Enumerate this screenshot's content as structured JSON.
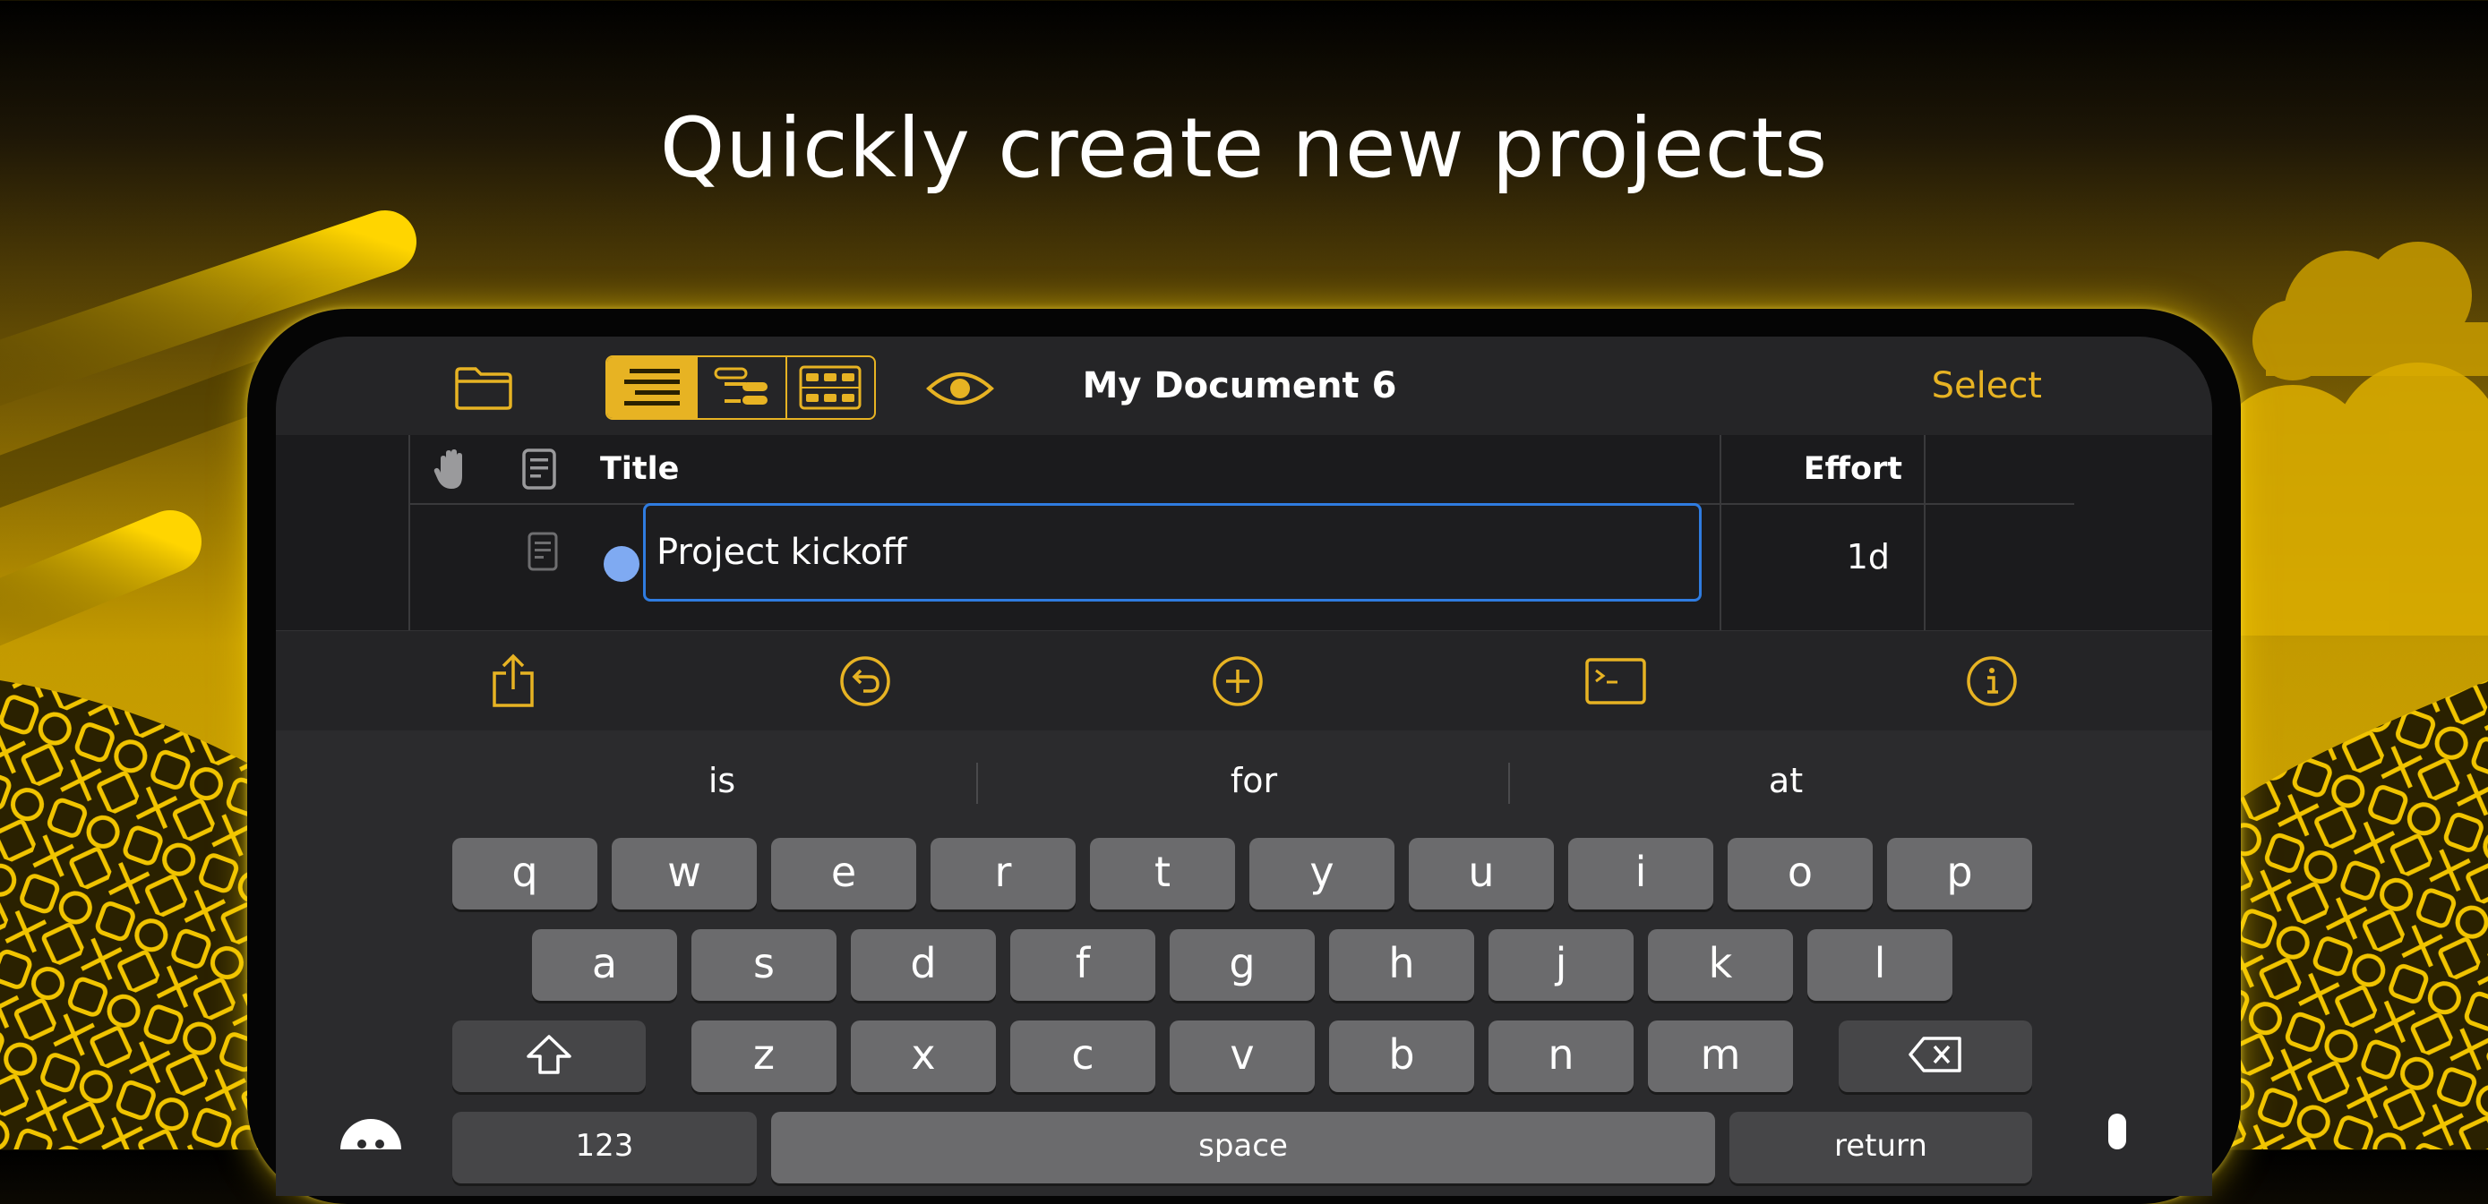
{
  "headline": "Quickly create new projects",
  "toolbar": {
    "title": "My Document 6",
    "select_label": "Select",
    "accent_color": "#e7b323"
  },
  "table": {
    "columns": {
      "title": "Title",
      "effort": "Effort"
    },
    "rows": [
      {
        "title": "Project kickoff",
        "effort": "1d",
        "status_color": "#7faaf2"
      }
    ]
  },
  "action_bar": {
    "icons": [
      "share-icon",
      "undo-icon",
      "add-icon",
      "console-icon",
      "info-icon"
    ]
  },
  "keyboard": {
    "suggestions": [
      "is",
      "for",
      "at"
    ],
    "row1": [
      "q",
      "w",
      "e",
      "r",
      "t",
      "y",
      "u",
      "i",
      "o",
      "p"
    ],
    "row2": [
      "a",
      "s",
      "d",
      "f",
      "g",
      "h",
      "j",
      "k",
      "l"
    ],
    "row3": [
      "z",
      "x",
      "c",
      "v",
      "b",
      "n",
      "m"
    ],
    "numbers_label": "123",
    "space_label": "space",
    "return_label": "return"
  }
}
